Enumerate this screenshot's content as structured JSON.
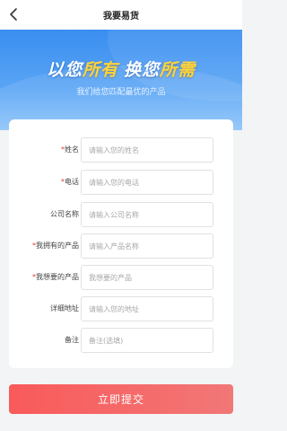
{
  "nav": {
    "title": "我要易货"
  },
  "banner": {
    "slogan_1_white": "以您",
    "slogan_1_yellow": "所有",
    "slogan_2_white": "换您",
    "slogan_2_yellow": "所需",
    "subtitle": "我们给您匹配最优的产品"
  },
  "form": {
    "fields": [
      {
        "required": "*",
        "label": "姓名",
        "placeholder": "请输入您的姓名",
        "value": ""
      },
      {
        "required": "*",
        "label": "电话",
        "placeholder": "请输入您的电话",
        "value": ""
      },
      {
        "required": "",
        "label": "公司名称",
        "placeholder": "请输入公司名称",
        "value": ""
      },
      {
        "required": "*",
        "label": "我拥有的产品",
        "placeholder": "请输入产品名称",
        "value": ""
      },
      {
        "required": "*",
        "label": "我想要的产品",
        "placeholder": "我想要的产品",
        "value": ""
      },
      {
        "required": "",
        "label": "详细地址",
        "placeholder": "请输入您的地址",
        "value": ""
      },
      {
        "required": "",
        "label": "备注",
        "placeholder": "备注(选填)",
        "value": ""
      }
    ],
    "submit_label": "立即提交"
  },
  "colors": {
    "banner": "#3a8ef0",
    "accent_yellow": "#ffd43a",
    "submit": "#f95a5a",
    "required": "#e23c3c"
  },
  "icons": {
    "back": "chevron-left-icon"
  }
}
